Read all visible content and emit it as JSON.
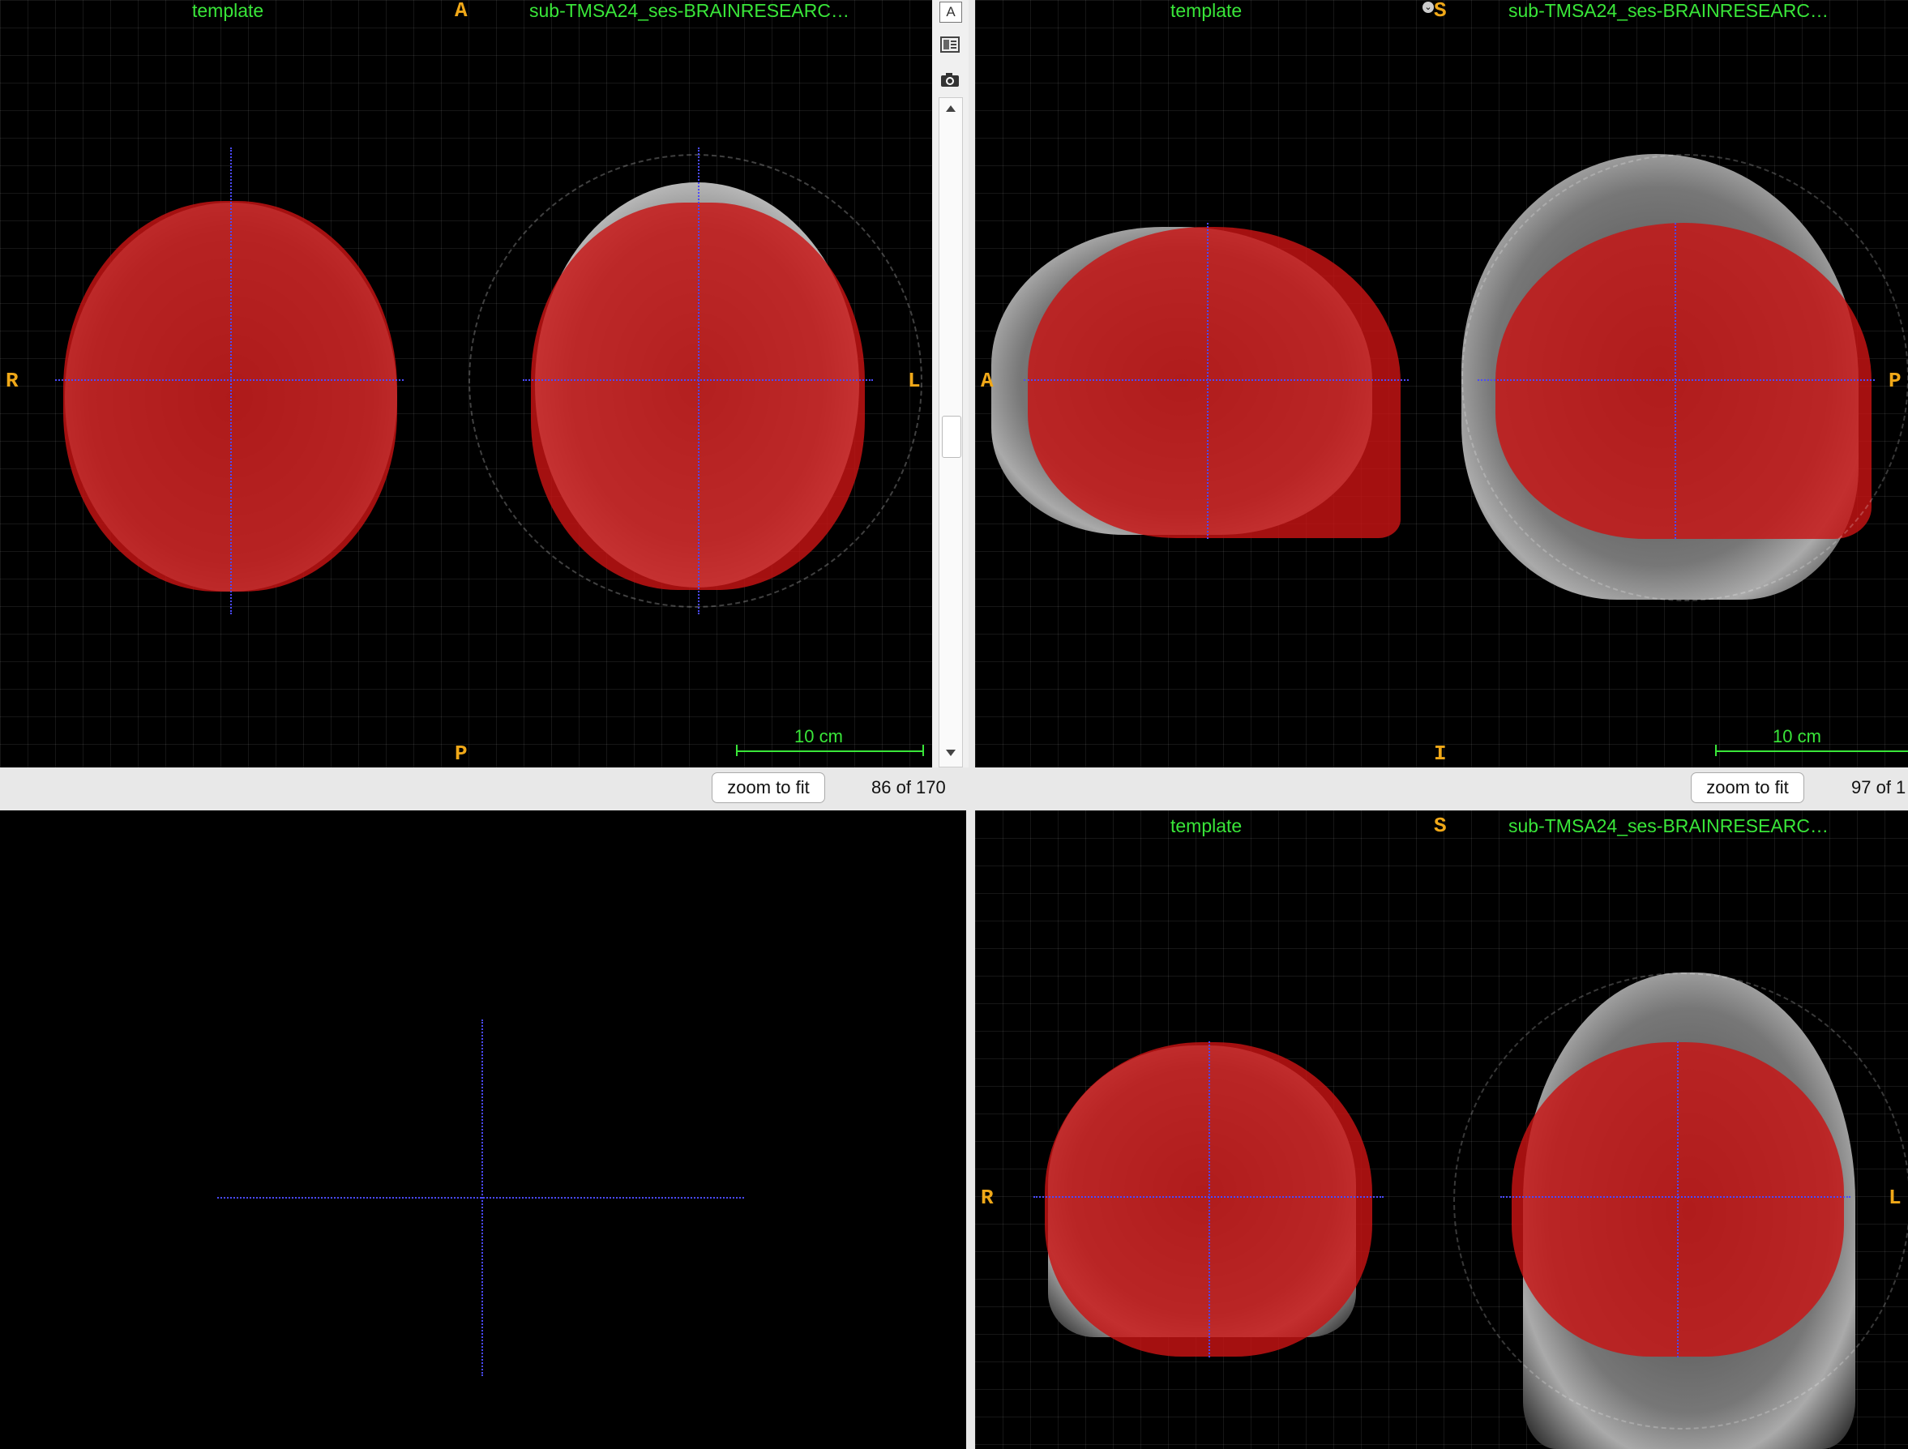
{
  "views": {
    "axial": {
      "template_label": "template",
      "subject_label": "sub-TMSA24_ses-BRAINRESEARC…",
      "top": "A",
      "bottom": "P",
      "left": "R",
      "right": "L",
      "scale": "10 cm",
      "zoom_label": "zoom to fit",
      "slice": "86 of 170"
    },
    "sagittal": {
      "template_label": "template",
      "subject_label": "sub-TMSA24_ses-BRAINRESEARC…",
      "top": "S",
      "bottom": "I",
      "left": "A",
      "right": "P",
      "scale": "10 cm",
      "zoom_label": "zoom to fit",
      "slice": "97 of 1"
    },
    "coronal": {
      "template_label": "template",
      "subject_label": "sub-TMSA24_ses-BRAINRESEARC…",
      "top": "S",
      "left": "R",
      "right": "L"
    }
  },
  "sidebar": {
    "text_icon": "A",
    "icons": [
      "layout-icon",
      "camera-icon",
      "scroll-up-icon",
      "scroll-down-icon"
    ]
  },
  "colors": {
    "label": "#39e639",
    "orientation": "#f0a818",
    "crosshair": "#4a4aff",
    "overlay": "#c81414"
  }
}
